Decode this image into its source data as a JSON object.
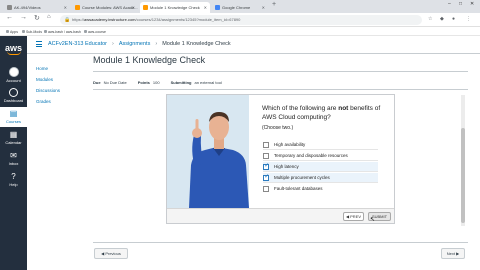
{
  "browser": {
    "tabs": [
      {
        "label": "AK-494/Videos"
      },
      {
        "label": "Course Modules: AWS Acade..."
      },
      {
        "label": "Module 1 Knowledge Check"
      },
      {
        "label": "Google Chrome"
      }
    ],
    "active_tab_index": 2,
    "address": {
      "prefix": "https://",
      "host": "awsacademy.instructure.com",
      "path": "/courses/1234/assignments/12345?module_item_id=67890"
    },
    "bookmarks": [
      {
        "label": "Apps"
      },
      {
        "label": "Sub-Mods"
      },
      {
        "label": "aws-bash / aws-bash"
      },
      {
        "label": "aws-course"
      }
    ]
  },
  "global_nav": {
    "logo": "aws",
    "items": [
      {
        "label": "Account"
      },
      {
        "label": "Dashboard"
      },
      {
        "label": "Courses"
      },
      {
        "label": "Calendar"
      },
      {
        "label": "Inbox"
      },
      {
        "label": "Help"
      }
    ],
    "active_index": 2
  },
  "breadcrumb": {
    "course": "ACFv2EN-313 Educator",
    "section": "Assignments",
    "current": "Module 1 Knowledge Check"
  },
  "course_nav": {
    "items": [
      {
        "label": "Home"
      },
      {
        "label": "Modules"
      },
      {
        "label": "Discussions"
      },
      {
        "label": "Grades"
      }
    ]
  },
  "assignment": {
    "title": "Module 1 Knowledge Check",
    "due_label": "Due",
    "due_value": "No Due Date",
    "points_label": "Points",
    "points_value": "100",
    "submitting_label": "Submitting",
    "submitting_value": "an external tool"
  },
  "quiz": {
    "question_part1": "Which of the following are ",
    "question_emph": "not",
    "question_part2": " benefits of AWS Cloud computing?",
    "instruction": "(Choose two.)",
    "options": [
      {
        "label": "High availability",
        "checked": false
      },
      {
        "label": "Temporary and disposable resources",
        "checked": false
      },
      {
        "label": "High latency",
        "checked": true
      },
      {
        "label": "Multiple procurement cycles",
        "checked": true
      },
      {
        "label": "Fault-tolerant databases",
        "checked": false
      }
    ],
    "prev_label": "◀ PREV",
    "submit_label": "SUBMIT"
  },
  "footer": {
    "previous_label": "◀ Previous",
    "next_label": "Next ▶"
  }
}
